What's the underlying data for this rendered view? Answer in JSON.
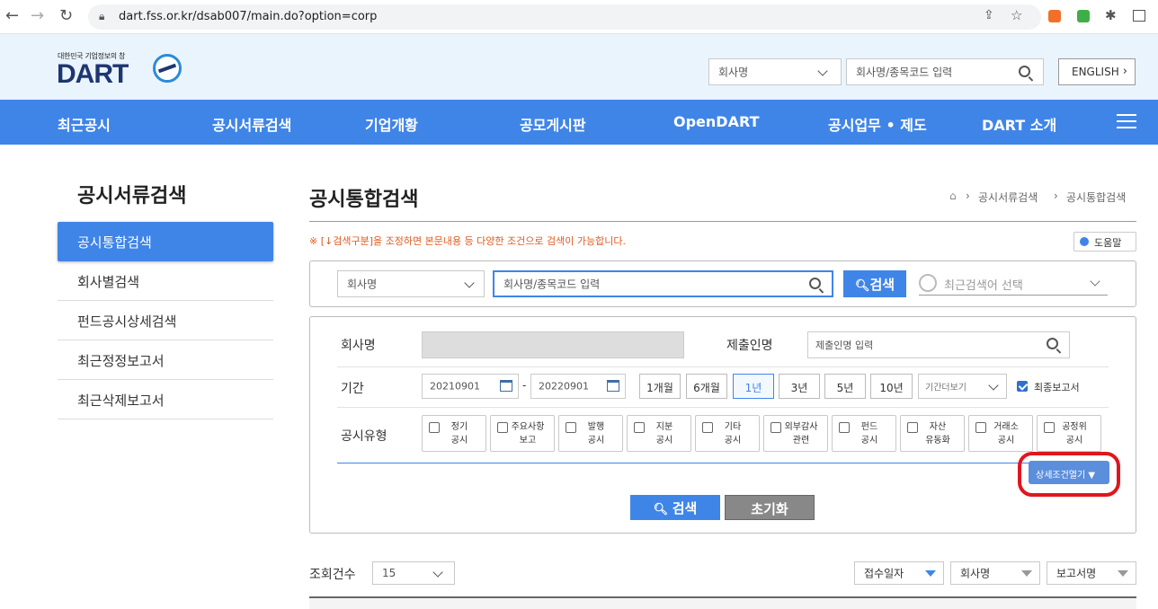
{
  "browser": {
    "url": "dart.fss.or.kr/dsab007/main.do?option=corp"
  },
  "header": {
    "logo_small": "대한민국 기업정보의 창",
    "logo_text": "DART",
    "search_scope": "회사명",
    "search_placeholder": "회사명/종목코드 입력",
    "english_label": "ENGLISH"
  },
  "menu": [
    "최근공시",
    "공시서류검색",
    "기업개황",
    "공모게시판",
    "OpenDART",
    "공시업무 • 제도",
    "DART 소개"
  ],
  "sidebar": {
    "title": "공시서류검색",
    "items": [
      {
        "label": "공시통합검색",
        "active": true
      },
      {
        "label": "회사별검색"
      },
      {
        "label": "펀드공시상세검색"
      },
      {
        "label": "최근정정보고서"
      },
      {
        "label": "최근삭제보고서"
      }
    ]
  },
  "main": {
    "title": "공시통합검색",
    "breadcrumb": [
      "공시서류검색",
      "공시통합검색"
    ],
    "notice": "※ [↓검색구분]을 조정하면 본문내용 등 다양한 조건으로 검색이 가능합니다.",
    "help": "도움말",
    "search": {
      "scope": "회사명",
      "placeholder": "회사명/종목코드 입력",
      "button": "검색",
      "recent": "최근검색어 선택"
    },
    "filters": {
      "company_label": "회사명",
      "submitter_label": "제출인명",
      "submitter_placeholder": "제출인명 입력",
      "period_label": "기간",
      "start_date": "20210901",
      "date_sep": "-",
      "end_date": "20220901",
      "period_buttons": [
        "1개월",
        "6개월",
        "1년",
        "3년",
        "5년",
        "10년"
      ],
      "period_active": "1년",
      "period_more": "기간더보기",
      "final_report": "최종보고서",
      "final_report_checked": true,
      "type_label": "공시유형",
      "types": [
        [
          "정기",
          "공시"
        ],
        [
          "주요사항",
          "보고"
        ],
        [
          "발행",
          "공시"
        ],
        [
          "지분",
          "공시"
        ],
        [
          "기타",
          "공시"
        ],
        [
          "외부감사",
          "관련"
        ],
        [
          "펀드",
          "공시"
        ],
        [
          "자산",
          "유동화"
        ],
        [
          "거래소",
          "공시"
        ],
        [
          "공정위",
          "공시"
        ]
      ],
      "detail_toggle": "상세조건열기 ▼",
      "search_button": "검색",
      "reset_button": "초기화"
    },
    "list": {
      "count_label": "조회건수",
      "page_size": "15",
      "sort_options": [
        "접수일자",
        "회사명",
        "보고서명"
      ]
    }
  },
  "colors": {
    "primary": "#3f85e8",
    "navy": "#1e3670",
    "notice": "#e05a1f",
    "highlight": "#e0161e"
  }
}
